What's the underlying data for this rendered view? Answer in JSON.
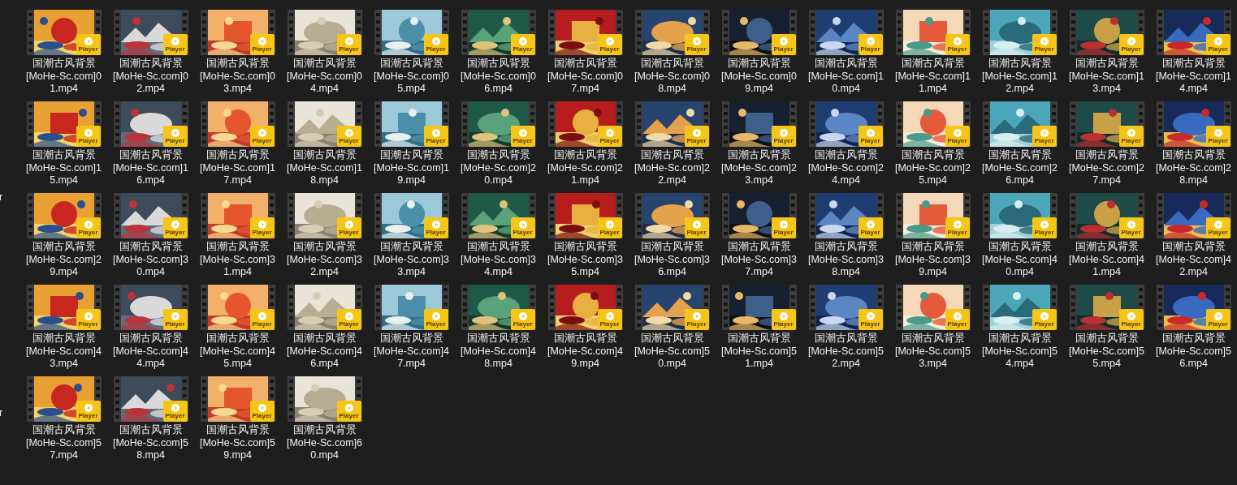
{
  "left_pane_fragments": [
    "r",
    "r"
  ],
  "files": [
    {
      "name_lines": [
        "国潮古风背景",
        "[MoHe-Sc.com]0",
        "1.mp4"
      ],
      "badge": "Player"
    },
    {
      "name_lines": [
        "国潮古风背景",
        "[MoHe-Sc.com]0",
        "2.mp4"
      ],
      "badge": "Player"
    },
    {
      "name_lines": [
        "国潮古风背景",
        "[MoHe-Sc.com]0",
        "3.mp4"
      ],
      "badge": "Player"
    },
    {
      "name_lines": [
        "国潮古风背景",
        "[MoHe-Sc.com]0",
        "4.mp4"
      ],
      "badge": "Player"
    },
    {
      "name_lines": [
        "国潮古风背景",
        "[MoHe-Sc.com]0",
        "5.mp4"
      ],
      "badge": "Player"
    },
    {
      "name_lines": [
        "国潮古风背景",
        "[MoHe-Sc.com]0",
        "6.mp4"
      ],
      "badge": "Player"
    },
    {
      "name_lines": [
        "国潮古风背景",
        "[MoHe-Sc.com]0",
        "7.mp4"
      ],
      "badge": "Player"
    },
    {
      "name_lines": [
        "国潮古风背景",
        "[MoHe-Sc.com]0",
        "8.mp4"
      ],
      "badge": "Player"
    },
    {
      "name_lines": [
        "国潮古风背景",
        "[MoHe-Sc.com]0",
        "9.mp4"
      ],
      "badge": "Player"
    },
    {
      "name_lines": [
        "国潮古风背景",
        "[MoHe-Sc.com]1",
        "0.mp4"
      ],
      "badge": "Player"
    },
    {
      "name_lines": [
        "国潮古风背景",
        "[MoHe-Sc.com]1",
        "1.mp4"
      ],
      "badge": "Player"
    },
    {
      "name_lines": [
        "国潮古风背景",
        "[MoHe-Sc.com]1",
        "2.mp4"
      ],
      "badge": "Player"
    },
    {
      "name_lines": [
        "国潮古风背景",
        "[MoHe-Sc.com]1",
        "3.mp4"
      ],
      "badge": "Player"
    },
    {
      "name_lines": [
        "国潮古风背景",
        "[MoHe-Sc.com]1",
        "4.mp4"
      ],
      "badge": "Player"
    },
    {
      "name_lines": [
        "国潮古风背景",
        "[MoHe-Sc.com]1",
        "5.mp4"
      ],
      "badge": "Player"
    },
    {
      "name_lines": [
        "国潮古风背景",
        "[MoHe-Sc.com]1",
        "6.mp4"
      ],
      "badge": "Player"
    },
    {
      "name_lines": [
        "国潮古风背景",
        "[MoHe-Sc.com]1",
        "7.mp4"
      ],
      "badge": "Player"
    },
    {
      "name_lines": [
        "国潮古风背景",
        "[MoHe-Sc.com]1",
        "8.mp4"
      ],
      "badge": "Player"
    },
    {
      "name_lines": [
        "国潮古风背景",
        "[MoHe-Sc.com]1",
        "9.mp4"
      ],
      "badge": "Player"
    },
    {
      "name_lines": [
        "国潮古风背景",
        "[MoHe-Sc.com]2",
        "0.mp4"
      ],
      "badge": "Player"
    },
    {
      "name_lines": [
        "国潮古风背景",
        "[MoHe-Sc.com]2",
        "1.mp4"
      ],
      "badge": "Player"
    },
    {
      "name_lines": [
        "国潮古风背景",
        "[MoHe-Sc.com]2",
        "2.mp4"
      ],
      "badge": "Player"
    },
    {
      "name_lines": [
        "国潮古风背景",
        "[MoHe-Sc.com]2",
        "3.mp4"
      ],
      "badge": "Player"
    },
    {
      "name_lines": [
        "国潮古风背景",
        "[MoHe-Sc.com]2",
        "4.mp4"
      ],
      "badge": "Player"
    },
    {
      "name_lines": [
        "国潮古风背景",
        "[MoHe-Sc.com]2",
        "5.mp4"
      ],
      "badge": "Player"
    },
    {
      "name_lines": [
        "国潮古风背景",
        "[MoHe-Sc.com]2",
        "6.mp4"
      ],
      "badge": "Player"
    },
    {
      "name_lines": [
        "国潮古风背景",
        "[MoHe-Sc.com]2",
        "7.mp4"
      ],
      "badge": "Player"
    },
    {
      "name_lines": [
        "国潮古风背景",
        "[MoHe-Sc.com]2",
        "8.mp4"
      ],
      "badge": "Player"
    },
    {
      "name_lines": [
        "国潮古风背景",
        "[MoHe-Sc.com]2",
        "9.mp4"
      ],
      "badge": "Player"
    },
    {
      "name_lines": [
        "国潮古风背景",
        "[MoHe-Sc.com]3",
        "0.mp4"
      ],
      "badge": "Player"
    },
    {
      "name_lines": [
        "国潮古风背景",
        "[MoHe-Sc.com]3",
        "1.mp4"
      ],
      "badge": "Player"
    },
    {
      "name_lines": [
        "国潮古风背景",
        "[MoHe-Sc.com]3",
        "2.mp4"
      ],
      "badge": "Player"
    },
    {
      "name_lines": [
        "国潮古风背景",
        "[MoHe-Sc.com]3",
        "3.mp4"
      ],
      "badge": "Player"
    },
    {
      "name_lines": [
        "国潮古风背景",
        "[MoHe-Sc.com]3",
        "4.mp4"
      ],
      "badge": "Player"
    },
    {
      "name_lines": [
        "国潮古风背景",
        "[MoHe-Sc.com]3",
        "5.mp4"
      ],
      "badge": "Player"
    },
    {
      "name_lines": [
        "国潮古风背景",
        "[MoHe-Sc.com]3",
        "6.mp4"
      ],
      "badge": "Player"
    },
    {
      "name_lines": [
        "国潮古风背景",
        "[MoHe-Sc.com]3",
        "7.mp4"
      ],
      "badge": "Player"
    },
    {
      "name_lines": [
        "国潮古风背景",
        "[MoHe-Sc.com]3",
        "8.mp4"
      ],
      "badge": "Player"
    },
    {
      "name_lines": [
        "国潮古风背景",
        "[MoHe-Sc.com]3",
        "9.mp4"
      ],
      "badge": "Player"
    },
    {
      "name_lines": [
        "国潮古风背景",
        "[MoHe-Sc.com]4",
        "0.mp4"
      ],
      "badge": "Player"
    },
    {
      "name_lines": [
        "国潮古风背景",
        "[MoHe-Sc.com]4",
        "1.mp4"
      ],
      "badge": "Player"
    },
    {
      "name_lines": [
        "国潮古风背景",
        "[MoHe-Sc.com]4",
        "2.mp4"
      ],
      "badge": "Player"
    },
    {
      "name_lines": [
        "国潮古风背景",
        "[MoHe-Sc.com]4",
        "3.mp4"
      ],
      "badge": "Player"
    },
    {
      "name_lines": [
        "国潮古风背景",
        "[MoHe-Sc.com]4",
        "4.mp4"
      ],
      "badge": "Player"
    },
    {
      "name_lines": [
        "国潮古风背景",
        "[MoHe-Sc.com]4",
        "5.mp4"
      ],
      "badge": "Player"
    },
    {
      "name_lines": [
        "国潮古风背景",
        "[MoHe-Sc.com]4",
        "6.mp4"
      ],
      "badge": "Player"
    },
    {
      "name_lines": [
        "国潮古风背景",
        "[MoHe-Sc.com]4",
        "7.mp4"
      ],
      "badge": "Player"
    },
    {
      "name_lines": [
        "国潮古风背景",
        "[MoHe-Sc.com]4",
        "8.mp4"
      ],
      "badge": "Player"
    },
    {
      "name_lines": [
        "国潮古风背景",
        "[MoHe-Sc.com]4",
        "9.mp4"
      ],
      "badge": "Player"
    },
    {
      "name_lines": [
        "国潮古风背景",
        "[MoHe-Sc.com]5",
        "0.mp4"
      ],
      "badge": "Player"
    },
    {
      "name_lines": [
        "国潮古风背景",
        "[MoHe-Sc.com]5",
        "1.mp4"
      ],
      "badge": "Player"
    },
    {
      "name_lines": [
        "国潮古风背景",
        "[MoHe-Sc.com]5",
        "2.mp4"
      ],
      "badge": "Player"
    },
    {
      "name_lines": [
        "国潮古风背景",
        "[MoHe-Sc.com]5",
        "3.mp4"
      ],
      "badge": "Player"
    },
    {
      "name_lines": [
        "国潮古风背景",
        "[MoHe-Sc.com]5",
        "4.mp4"
      ],
      "badge": "Player"
    },
    {
      "name_lines": [
        "国潮古风背景",
        "[MoHe-Sc.com]5",
        "5.mp4"
      ],
      "badge": "Player"
    },
    {
      "name_lines": [
        "国潮古风背景",
        "[MoHe-Sc.com]5",
        "6.mp4"
      ],
      "badge": "Player"
    },
    {
      "name_lines": [
        "国潮古风背景",
        "[MoHe-Sc.com]5",
        "7.mp4"
      ],
      "badge": "Player"
    },
    {
      "name_lines": [
        "国潮古风背景",
        "[MoHe-Sc.com]5",
        "8.mp4"
      ],
      "badge": "Player"
    },
    {
      "name_lines": [
        "国潮古风背景",
        "[MoHe-Sc.com]5",
        "9.mp4"
      ],
      "badge": "Player"
    },
    {
      "name_lines": [
        "国潮古风背景",
        "[MoHe-Sc.com]6",
        "0.mp4"
      ],
      "badge": "Player"
    }
  ]
}
